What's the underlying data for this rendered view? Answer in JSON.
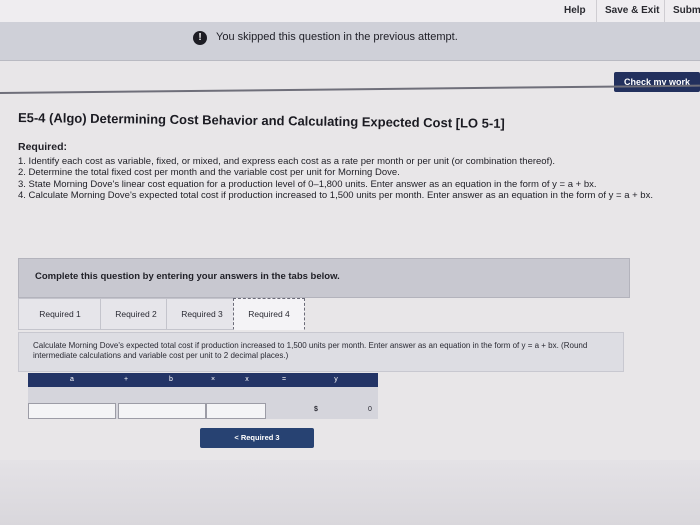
{
  "topbar": {
    "help": "Help",
    "save_exit": "Save & Exit",
    "submit": "Subm"
  },
  "banner": {
    "icon": "!",
    "text": "You skipped this question in the previous attempt."
  },
  "check_button": "Check my work",
  "title": "E5-4 (Algo) Determining Cost Behavior and Calculating Expected Cost [LO 5-1]",
  "required": {
    "heading": "Required:",
    "items": [
      "1. Identify each cost as variable, fixed, or mixed, and express each cost as a rate per month or per unit (or combination thereof).",
      "2. Determine the total fixed cost per month and the variable cost per unit for Morning Dove.",
      "3. State Morning Dove's linear cost equation for a production level of 0–1,800 units. Enter answer as an equation in the form of y = a + bx.",
      "4. Calculate Morning Dove's expected total cost if production increased to 1,500 units per month. Enter answer as an equation in the form of y = a + bx."
    ]
  },
  "complete_text": "Complete this question by entering your answers in the tabs below.",
  "tabs": [
    "Required 1",
    "Required 2",
    "Required 3",
    "Required 4"
  ],
  "active_tab": "Required 4",
  "instructions": "Calculate Morning Dove's expected total cost if production increased to 1,500 units per month. Enter answer as an equation in the form of y = a + bx. (Round intermediate calculations and variable cost per unit to 2 decimal places.)",
  "equation": {
    "headers": [
      "a",
      "+",
      "b",
      "×",
      "x",
      "=",
      "y"
    ],
    "dollar": "$",
    "y_value": "0"
  },
  "prev_button": "< Required 3",
  "colors": {
    "nav_dark": "#233466",
    "button_dark": "#22305d"
  }
}
